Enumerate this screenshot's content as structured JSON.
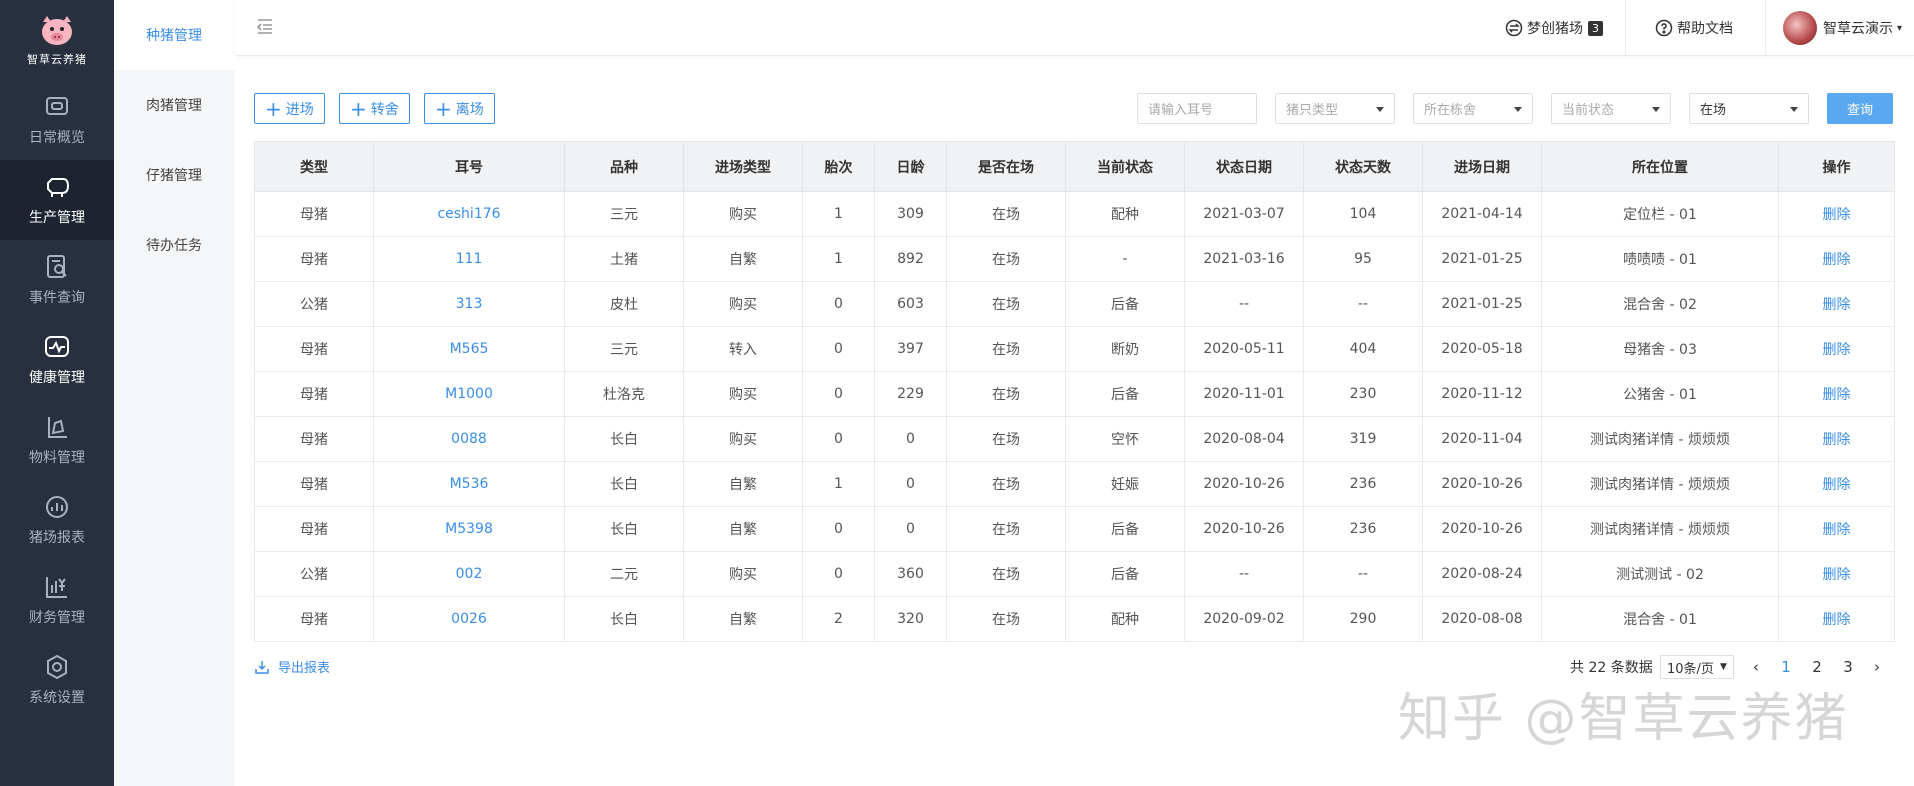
{
  "brand": {
    "name": "智草云养猪"
  },
  "sidebar": {
    "items": [
      {
        "label": "日常概览",
        "icon": "monitor-icon"
      },
      {
        "label": "生产管理",
        "icon": "pig-icon"
      },
      {
        "label": "事件查询",
        "icon": "document-search-icon"
      },
      {
        "label": "健康管理",
        "icon": "health-monitor-icon"
      },
      {
        "label": "物料管理",
        "icon": "feed-icon"
      },
      {
        "label": "猪场报表",
        "icon": "chart-icon"
      },
      {
        "label": "财务管理",
        "icon": "finance-icon"
      },
      {
        "label": "系统设置",
        "icon": "gear-icon"
      }
    ]
  },
  "submenu": {
    "items": [
      {
        "label": "种猪管理"
      },
      {
        "label": "肉猪管理"
      },
      {
        "label": "仔猪管理"
      },
      {
        "label": "待办任务"
      }
    ]
  },
  "header": {
    "farm_label": "梦创猪场",
    "farm_count": "3",
    "help_label": "帮助文档",
    "user_name": "智草云演示"
  },
  "toolbar": {
    "enter_label": "进场",
    "transfer_label": "转舍",
    "leave_label": "离场",
    "ear_placeholder": "请输入耳号",
    "pig_type_placeholder": "猪只类型",
    "building_placeholder": "所在栋舍",
    "status_placeholder": "当前状态",
    "presence_value": "在场",
    "query_label": "查询"
  },
  "table": {
    "columns": [
      "类型",
      "耳号",
      "品种",
      "进场类型",
      "胎次",
      "日龄",
      "是否在场",
      "当前状态",
      "状态日期",
      "状态天数",
      "进场日期",
      "所在位置",
      "操作"
    ],
    "action_label": "删除",
    "rows": [
      [
        "母猪",
        "ceshi176",
        "三元",
        "购买",
        "1",
        "309",
        "在场",
        "配种",
        "2021-03-07",
        "104",
        "2021-04-14",
        "定位栏 - 01"
      ],
      [
        "母猪",
        "111",
        "土猪",
        "自繁",
        "1",
        "892",
        "在场",
        "-",
        "2021-03-16",
        "95",
        "2021-01-25",
        "啧啧啧 - 01"
      ],
      [
        "公猪",
        "313",
        "皮杜",
        "购买",
        "0",
        "603",
        "在场",
        "后备",
        "--",
        "--",
        "2021-01-25",
        "混合舍 - 02"
      ],
      [
        "母猪",
        "M565",
        "三元",
        "转入",
        "0",
        "397",
        "在场",
        "断奶",
        "2020-05-11",
        "404",
        "2020-05-18",
        "母猪舍 - 03"
      ],
      [
        "母猪",
        "M1000",
        "杜洛克",
        "购买",
        "0",
        "229",
        "在场",
        "后备",
        "2020-11-01",
        "230",
        "2020-11-12",
        "公猪舍 - 01"
      ],
      [
        "母猪",
        "0088",
        "长白",
        "购买",
        "0",
        "0",
        "在场",
        "空怀",
        "2020-08-04",
        "319",
        "2020-11-04",
        "测试肉猪详情 - 烦烦烦"
      ],
      [
        "母猪",
        "M536",
        "长白",
        "自繁",
        "1",
        "0",
        "在场",
        "妊娠",
        "2020-10-26",
        "236",
        "2020-10-26",
        "测试肉猪详情 - 烦烦烦"
      ],
      [
        "母猪",
        "M5398",
        "长白",
        "自繁",
        "0",
        "0",
        "在场",
        "后备",
        "2020-10-26",
        "236",
        "2020-10-26",
        "测试肉猪详情 - 烦烦烦"
      ],
      [
        "公猪",
        "002",
        "二元",
        "购买",
        "0",
        "360",
        "在场",
        "后备",
        "--",
        "--",
        "2020-08-24",
        "测试测试 - 02"
      ],
      [
        "母猪",
        "0026",
        "长白",
        "自繁",
        "2",
        "320",
        "在场",
        "配种",
        "2020-09-02",
        "290",
        "2020-08-08",
        "混合舍 - 01"
      ]
    ]
  },
  "footer": {
    "export_label": "导出报表",
    "total_label": "共 22 条数据",
    "page_size": "10条/页",
    "prev": "‹",
    "next": "›",
    "pages": [
      "1",
      "2",
      "3"
    ],
    "current_page": "1"
  },
  "watermark": "知乎 @智草云养猪",
  "colors": {
    "accent": "#3a8ee6",
    "sidebar_bg": "#28303f",
    "query_btn": "#5aa8f0"
  }
}
